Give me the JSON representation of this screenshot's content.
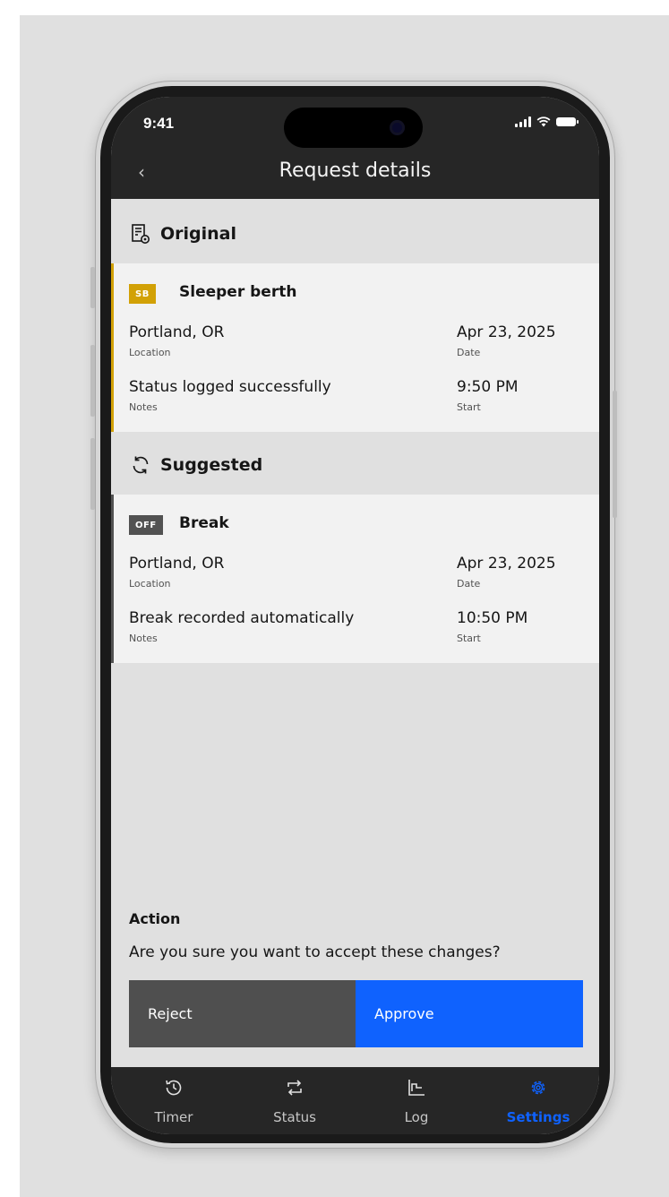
{
  "status_bar": {
    "time": "9:41"
  },
  "header": {
    "back_label": "‹",
    "title": "Request details"
  },
  "original": {
    "heading": "Original",
    "tag": "SB",
    "status": "Sleeper berth",
    "location": "Portland, OR",
    "location_caption": "Location",
    "date": "Apr 23, 2025",
    "date_caption": "Date",
    "notes": "Status logged successfully",
    "notes_caption": "Notes",
    "start": "9:50 PM",
    "start_caption": "Start",
    "accent": "#d2a106"
  },
  "suggested": {
    "heading": "Suggested",
    "tag": "OFF",
    "status": "Break",
    "location": "Portland, OR",
    "location_caption": "Location",
    "date": "Apr 23, 2025",
    "date_caption": "Date",
    "notes": "Break recorded automatically",
    "notes_caption": "Notes",
    "start": "10:50 PM",
    "start_caption": "Start",
    "accent": "#525252"
  },
  "action": {
    "title": "Action",
    "question": "Are you sure you want to accept these changes?",
    "reject_label": "Reject",
    "approve_label": "Approve"
  },
  "tabs": [
    {
      "label": "Timer",
      "icon": "history-icon",
      "active": false
    },
    {
      "label": "Status",
      "icon": "swap-icon",
      "active": false
    },
    {
      "label": "Log",
      "icon": "step-chart-icon",
      "active": false
    },
    {
      "label": "Settings",
      "icon": "gear-icon",
      "active": true
    }
  ],
  "colors": {
    "header_bg": "#262626",
    "primary": "#0f62fe",
    "reject_bg": "#4f4f4f",
    "sb_tag": "#d2a106",
    "off_tag": "#525252"
  }
}
